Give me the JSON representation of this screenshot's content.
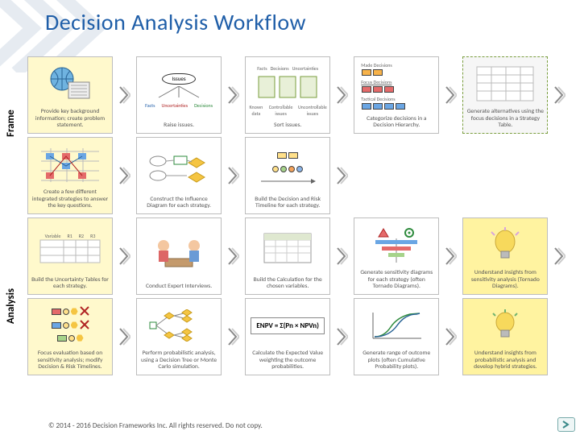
{
  "title": "Decision Analysis Workflow",
  "footer": "© 2014 - 2016 Decision Frameworks Inc. All rights reserved. Do not copy.",
  "rowLabels": {
    "frame": "Frame",
    "analysis": "Analysis"
  },
  "headerTiny": {
    "facts": "Facts",
    "decisions": "Decisions",
    "uncertainties": "Uncertainties",
    "known": "Known data",
    "controllable": "Controllable issues",
    "uncontrollable": "Uncontrollable issues",
    "made": "Made Decisions",
    "focus": "Focus Decisions",
    "tactical": "Tactical Decisions"
  },
  "cells": {
    "r1c1": "Provide key background information; create problem statement.",
    "r1c2_oval": "Issues",
    "r1c2_facts": "Facts",
    "r1c2_unc": "Uncertainties",
    "r1c2_dec": "Decisions",
    "r1c2": "Raise issues.",
    "r1c3": "Sort issues.",
    "r1c4": "Categorize decisions in a Decision Hierarchy.",
    "r1c5": "Generate alternatives using the focus decisions in a Strategy Table.",
    "r2c1": "Create a few different integrated strategies to answer the key questions.",
    "r2c2": "Construct the Influence Diagram for each strategy.",
    "r2c3": "Build the Decision and Risk Timeline for each strategy.",
    "r3c1_hdr_var": "Variable",
    "r3c1_hdr_r1": "R1",
    "r3c1_hdr_r2": "R2",
    "r3c1_hdr_r3": "R3",
    "r3c1": "Build the Uncertainty Tables for each strategy.",
    "r3c2": "Conduct Expert Interviews.",
    "r3c3": "Build the Calculation for the chosen variables.",
    "r3c4": "Generate sensitivity diagrams for each strategy (often Tornado Diagrams).",
    "r3c5": "Understand insights from sensitivity analysis (Tornado Diagrams).",
    "r4c1": "Focus evaluation based on sensitivity analysis; modify Decision & Risk Timelines.",
    "r4c2": "Perform probabilistic analysis, using a Decision Tree or Monte Carlo simulation.",
    "r4c3_formula": "ENPV = Σ(Pn × NPVn)",
    "r4c3": "Calculate the Expected Value weighting the outcome probabilities.",
    "r4c4": "Generate range of outcome plots (often Cumulative Probability plots).",
    "r4c5": "Understand insights from probabilistic analysis and develop hybrid strategies."
  }
}
